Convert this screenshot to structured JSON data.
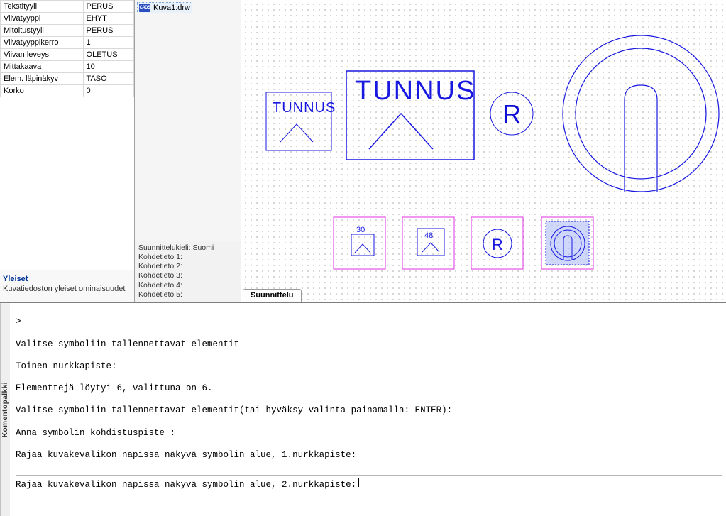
{
  "properties": {
    "rows": [
      {
        "k": "Tekstityyli",
        "v": "PERUS"
      },
      {
        "k": "Viivatyyppi",
        "v": "EHYT"
      },
      {
        "k": "Mitoitustyyli",
        "v": "PERUS"
      },
      {
        "k": "Viivatyyppikerro",
        "v": "1"
      },
      {
        "k": "Viivan leveys",
        "v": "OLETUS"
      },
      {
        "k": "Mittakaava",
        "v": "10"
      },
      {
        "k": "Elem. läpinäkyv",
        "v": "TASO"
      },
      {
        "k": "Korko",
        "v": "0"
      }
    ],
    "footer_title": "Yleiset",
    "footer_sub": "Kuvatiedoston yleiset ominaisuudet"
  },
  "file": {
    "icon": "CADS",
    "name": "Kuva1.drw"
  },
  "meta": {
    "l1": "Suunnittelukieli: Suomi",
    "l2": "Kohdetieto 1:",
    "l3": "Kohdetieto 2:",
    "l4": "Kohdetieto 3:",
    "l5": "Kohdetieto 4:",
    "l6": "Kohdetieto 5:"
  },
  "tab": {
    "label": "Suunnittelu"
  },
  "drawing": {
    "text_big": "TUNNUS",
    "text_small": "TUNNUS",
    "text_R": "R",
    "thumb_30": "30",
    "thumb_48": "48"
  },
  "cmd": {
    "handle": "Komentopalkki",
    "l1": ">",
    "l2": "Valitse symboliin tallennettavat elementit",
    "l3": "Toinen nurkkapiste:",
    "l4": "Elementtejä löytyi 6, valittuna on 6.",
    "l5": "Valitse symboliin tallennettavat elementit(tai hyväksy valinta painamalla: ENTER):",
    "l6": "Anna symbolin kohdistuspiste :",
    "l7": "Rajaa kuvakevalikon napissa näkyvä symbolin alue, 1.nurkkapiste:",
    "prompt": "Rajaa kuvakevalikon napissa näkyvä symbolin alue, 2.nurkkapiste:"
  }
}
